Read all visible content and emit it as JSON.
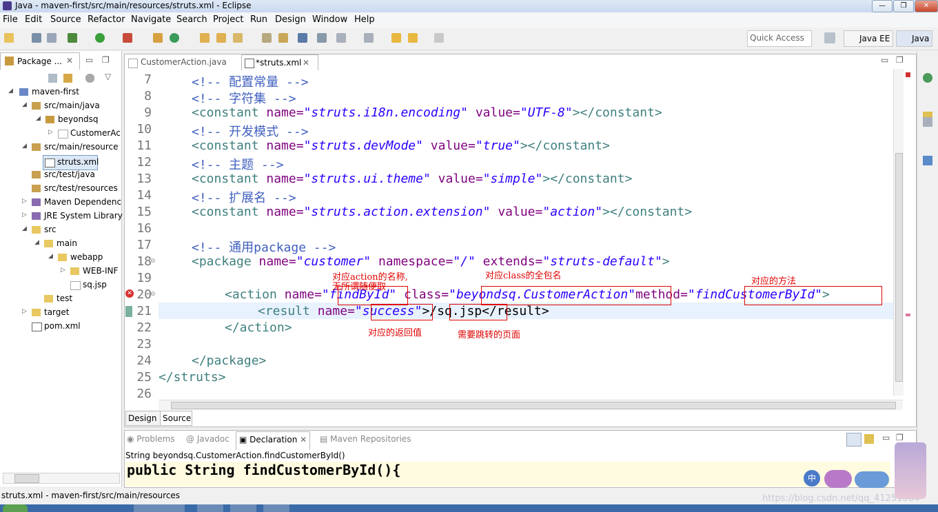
{
  "window": {
    "title": "Java - maven-first/src/main/resources/struts.xml - Eclipse"
  },
  "menu": [
    "File",
    "Edit",
    "Source",
    "Refactor",
    "Navigate",
    "Search",
    "Project",
    "Run",
    "Design",
    "Window",
    "Help"
  ],
  "quick_access": "Quick Access",
  "perspectives": [
    "Java EE",
    "Java"
  ],
  "package_explorer": {
    "tab": "Package ...",
    "items": [
      "maven-first",
      "src/main/java",
      "beyondsq",
      "CustomerAc",
      "src/main/resource",
      "struts.xml",
      "src/test/java",
      "src/test/resources",
      "Maven Dependenc",
      "JRE System Library",
      "src",
      "main",
      "webapp",
      "WEB-INF",
      "sq.jsp",
      "test",
      "target",
      "pom.xml"
    ]
  },
  "editor": {
    "tabs": [
      "CustomerAction.java",
      "*struts.xml"
    ],
    "line_numbers": [
      "7",
      "8",
      "9",
      "10",
      "11",
      "12",
      "13",
      "14",
      "15",
      "16",
      "17",
      "18",
      "19",
      "20",
      "21",
      "22",
      "23",
      "24",
      "25",
      "26"
    ],
    "lines": {
      "l7": "<!-- 配置常量 -->",
      "l8": "<!-- 字符集 -->",
      "l9a": "<constant ",
      "l9b": "name=",
      "l9c": "\"struts.i18n.encoding\"",
      "l9d": " value=",
      "l9e": "\"UTF-8\"",
      "l9f": "></constant>",
      "l10": "<!-- 开发模式 -->",
      "l11a": "<constant ",
      "l11b": "name=",
      "l11c": "\"struts.devMode\"",
      "l11d": " value=",
      "l11e": "\"true\"",
      "l11f": "></constant>",
      "l12": "<!-- 主题 -->",
      "l13a": "<constant ",
      "l13b": "name=",
      "l13c": "\"struts.ui.theme\"",
      "l13d": " value=",
      "l13e": "\"simple\"",
      "l13f": "></constant>",
      "l14": "<!-- 扩展名 -->",
      "l15a": "<constant ",
      "l15b": "name=",
      "l15c": "\"struts.action.extension\"",
      "l15d": " value=",
      "l15e": "\"action\"",
      "l15f": "></constant>",
      "l17": "<!-- 通用package -->",
      "l18a": "<package ",
      "l18b": "name=",
      "l18c": "\"customer\"",
      "l18d": " namespace=",
      "l18e": "\"/\"",
      "l18f": " extends=",
      "l18g": "\"struts-default\"",
      "l18h": ">",
      "l20a": "<action ",
      "l20b": "name=",
      "l20c": "\"findById\"",
      "l20d": " class=",
      "l20e": "\"beyondsq.CustomerAction\"",
      "l20f": "method=",
      "l20g": "\"findCustomerById\"",
      "l20h": ">",
      "l21a": "<result ",
      "l21b": "name=",
      "l21c": "\"success\"",
      "l21d": ">/sq.jsp</result>",
      "l22": "</action>",
      "l24": "</package>",
      "l25": "</struts>"
    },
    "bottom_tabs": [
      "Design",
      "Source"
    ]
  },
  "annotations": {
    "a1": "对应action的名称,",
    "a1b": "无所谓随便取",
    "a2": "对应class的全包名",
    "a3": "对应的方法",
    "a4": "对应的返回值",
    "a5": "需要跳转的页面"
  },
  "bottom_panel": {
    "tabs": [
      "Problems",
      "Javadoc",
      "Declaration",
      "Maven Repositories"
    ],
    "signature": "String beyondsq.CustomerAction.findCustomerById()",
    "code": "public String findCustomerById(){"
  },
  "status": "struts.xml - maven-first/src/main/resources",
  "watermark": "https://blog.csdn.net/qq_41251064"
}
